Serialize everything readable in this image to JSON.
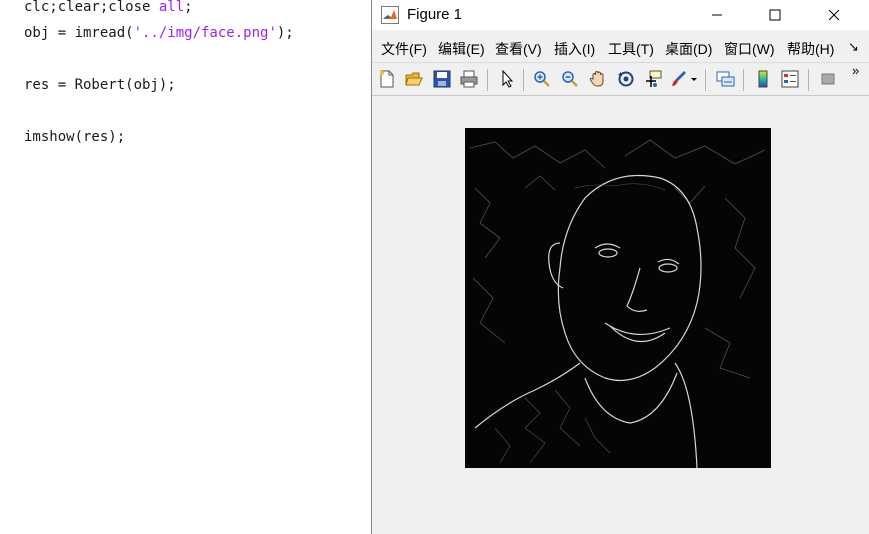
{
  "editor": {
    "lines": [
      {
        "pre": "clc;clear;close ",
        "str": "all",
        "post": ";"
      },
      {
        "pre": "obj = imread(",
        "str": "'../img/face.png'",
        "post": ");"
      },
      {
        "pre": "res = Robert(obj);",
        "str": "",
        "post": ""
      },
      {
        "pre": "imshow(res);",
        "str": "",
        "post": ""
      }
    ]
  },
  "figure": {
    "title": "Figure 1",
    "window_buttons": {
      "minimize": "—",
      "maximize": "☐",
      "close": "✕"
    },
    "menu": [
      {
        "label": "文件(F)"
      },
      {
        "label": "编辑(E)"
      },
      {
        "label": "查看(V)"
      },
      {
        "label": "插入(I)"
      },
      {
        "label": "工具(T)"
      },
      {
        "label": "桌面(D)"
      },
      {
        "label": "窗口(W)"
      },
      {
        "label": "帮助(H)"
      }
    ],
    "menu_more": "↘",
    "toolbar_more": "»"
  },
  "colors": {
    "string": "#a020f0",
    "image_bg": "#050505"
  }
}
